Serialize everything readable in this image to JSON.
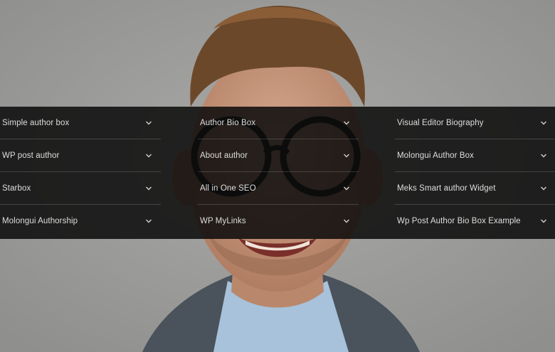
{
  "background": {
    "image": "portrait-photo",
    "description_colors": {
      "wall": "#a0a09e",
      "hair": "#6e4a2c",
      "skin": "#c99a7e",
      "jacket": "#4b5560",
      "shirt": "#a9c4dc"
    }
  },
  "overlay_color": "#0a0a0a",
  "accordion": {
    "columns": [
      {
        "items": [
          {
            "label": "Simple author box"
          },
          {
            "label": "WP post author"
          },
          {
            "label": "Starbox"
          },
          {
            "label": "Molongui Authorship"
          }
        ]
      },
      {
        "items": [
          {
            "label": "Author Bio Box"
          },
          {
            "label": "About author"
          },
          {
            "label": "All in One SEO"
          },
          {
            "label": "WP MyLinks"
          }
        ]
      },
      {
        "items": [
          {
            "label": "Visual Editor Biography"
          },
          {
            "label": "Molongui Author Box"
          },
          {
            "label": "Meks Smart author Widget"
          },
          {
            "label": "Wp Post Author Bio Box Example"
          }
        ]
      }
    ],
    "chevron_icon": "chevron-down-icon"
  }
}
